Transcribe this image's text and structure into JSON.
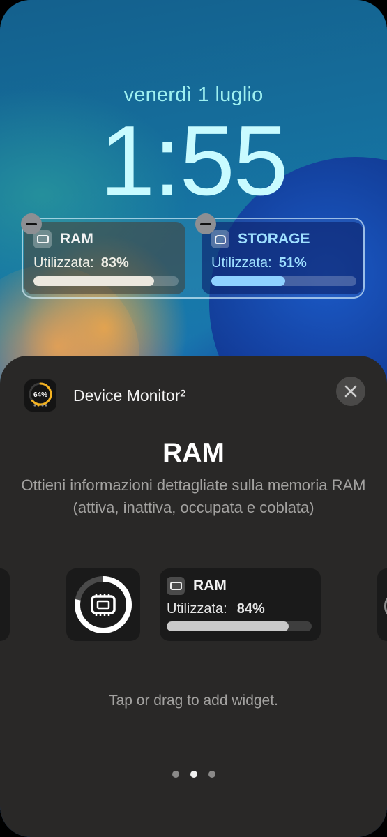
{
  "lock_screen": {
    "date": "venerdì 1 luglio",
    "time": "1:55",
    "widgets": [
      {
        "title": "RAM",
        "label": "Utilizzata:",
        "value": "83%",
        "fraction": 0.83,
        "icon": "memory-chip-icon"
      },
      {
        "title": "STORAGE",
        "label": "Utilizzata:",
        "value": "51%",
        "fraction": 0.51,
        "icon": "drive-icon"
      }
    ]
  },
  "sheet": {
    "app_name": "Device Monitor²",
    "app_icon_text": "64%",
    "app_icon_fraction": 0.64,
    "title": "RAM",
    "description": "Ottieni informazioni dettagliate sulla memoria RAM (attiva, inattiva, occupata e coblata)",
    "preview_circular": {
      "icon": "memory-chip-icon",
      "fraction": 0.78
    },
    "preview_rect": {
      "title": "RAM",
      "label": "Utilizzata:",
      "value": "84%",
      "fraction": 0.84
    },
    "hint": "Tap or drag to add widget.",
    "page_dots": {
      "count": 3,
      "active_index": 1
    }
  },
  "colors": {
    "sheet_bg": "#292827",
    "widget_bg": "#1a1a1a",
    "clock": "#c8fbff",
    "storage_accent": "#8fd1ff",
    "app_icon_ring": "#f5b321"
  }
}
